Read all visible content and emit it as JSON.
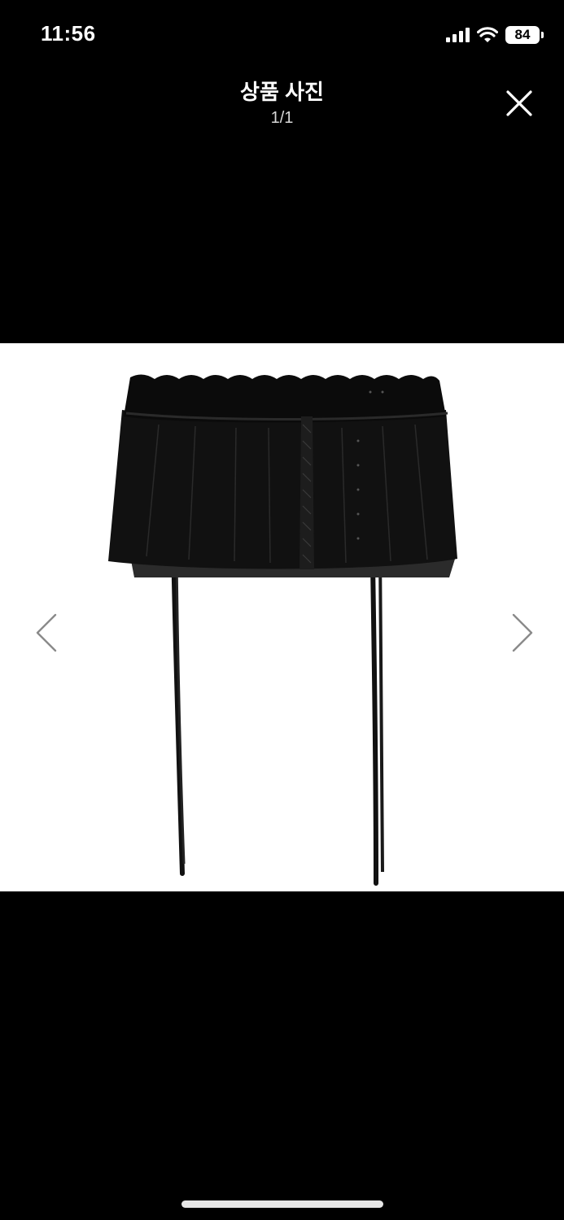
{
  "status_bar": {
    "time": "11:56",
    "battery": "84",
    "icons": [
      "cellular-signal-icon",
      "wifi-icon",
      "battery-icon"
    ]
  },
  "header": {
    "title": "상품 사진",
    "counter": "1/1",
    "close_icon": "close-icon"
  },
  "viewer": {
    "image_description": "black mini skirt with ruffled waistband and long ties",
    "prev_icon": "chevron-left-icon",
    "next_icon": "chevron-right-icon"
  },
  "colors": {
    "background": "#000000",
    "image_background": "#ffffff",
    "arrow": "#8a8a8a"
  }
}
